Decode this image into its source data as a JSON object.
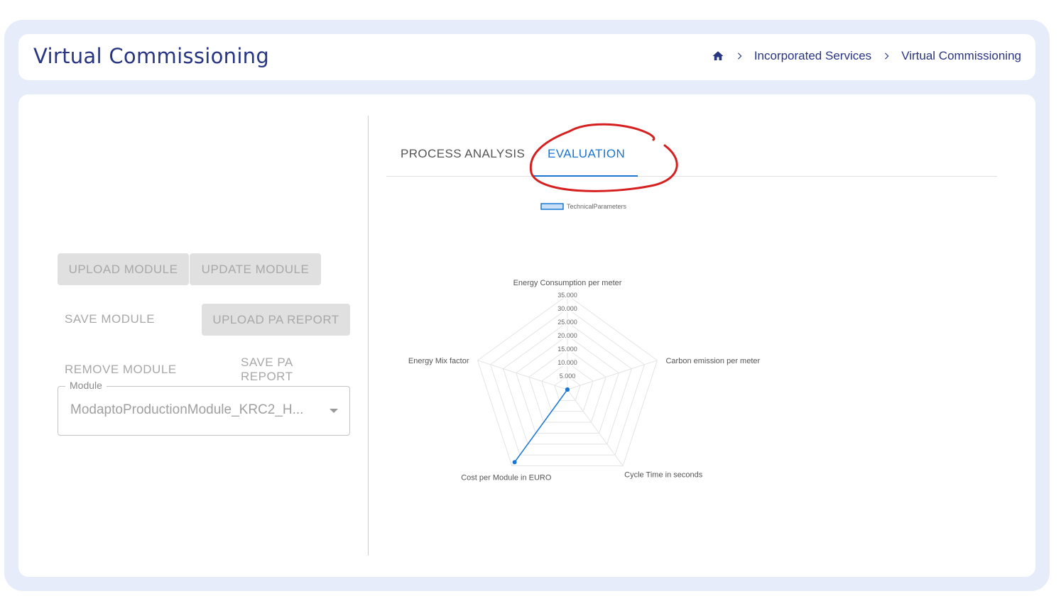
{
  "header": {
    "title": "Virtual Commissioning",
    "breadcrumb": [
      "Incorporated Services",
      "Virtual Commissioning"
    ]
  },
  "actions": {
    "upload_module": "UPLOAD MODULE",
    "update_module": "UPDATE MODULE",
    "save_module": "SAVE MODULE",
    "upload_pa_report": "UPLOAD PA REPORT",
    "remove_module": "REMOVE MODULE",
    "save_pa_report": "SAVE PA REPORT"
  },
  "module_select": {
    "label": "Module",
    "value": "ModaptoProductionModule_KRC2_H..."
  },
  "tabs": [
    {
      "label": "PROCESS ANALYSIS",
      "active": false
    },
    {
      "label": "EVALUATION",
      "active": true
    }
  ],
  "colors": {
    "brand": "#283583",
    "accent": "#1976d2",
    "annotation": "#d62020"
  },
  "chart_data": {
    "type": "radar",
    "legend": "TechnicalParameters",
    "axes": [
      "Energy Consumption per meter",
      "Carbon emission per meter",
      "Cycle Time in seconds",
      "Cost per Module in EURO",
      "Energy Mix factor"
    ],
    "ticks": [
      "5.000",
      "10.000",
      "15.000",
      "20.000",
      "25.000",
      "30.000",
      "35.000"
    ],
    "range": [
      0,
      35
    ],
    "series": [
      {
        "name": "TechnicalParameters",
        "values": [
          0,
          0,
          0,
          33.3,
          0
        ]
      }
    ]
  }
}
